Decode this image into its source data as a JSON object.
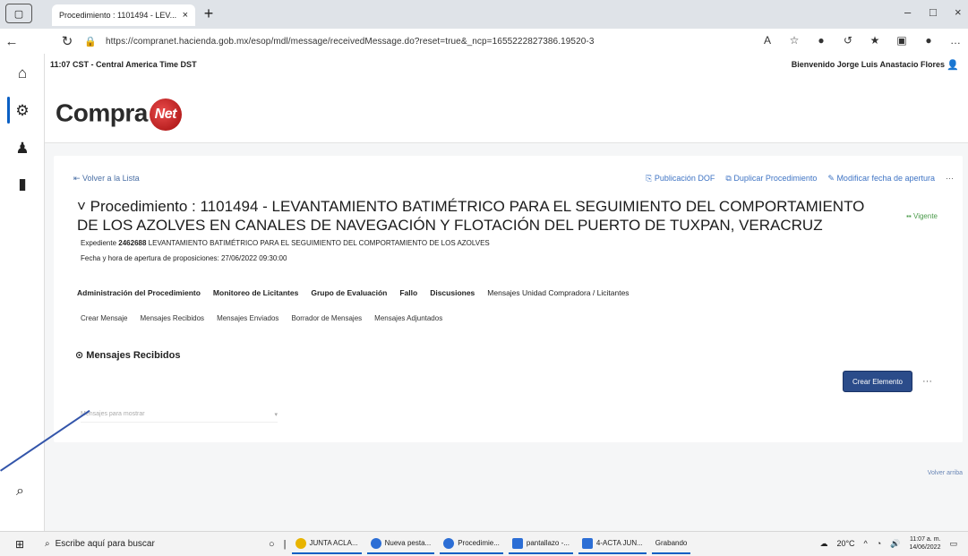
{
  "browser": {
    "tab_title": "Procedimiento : 1101494 - LEV...",
    "tab_close": "×",
    "new_tab": "+",
    "url": "https://compranet.hacienda.gob.mx/esop/mdl/message/receivedMessage.do?reset=true&_ncp=1655222827386.19520-3",
    "win_minimize": "–",
    "win_maximize": "□",
    "win_close": "×"
  },
  "page": {
    "time_zone": "11:07 CST - Central America Time DST",
    "welcome": "Bienvenido Jorge Luis Anastacio Flores",
    "logo_text": "Compra",
    "logo_badge": "Net",
    "back_link": "Volver a la Lista",
    "actions": {
      "publicacion": "Publicación DOF",
      "duplicar": "Duplicar Procedimiento",
      "modificar": "Modificar fecha de apertura",
      "more": "···"
    },
    "proc_title": "Procedimiento : 1101494 - LEVANTAMIENTO BATIMÉTRICO PARA EL SEGUIMIENTO DEL COMPORTAMIENTO DE LOS AZOLVES EN CANALES DE NAVEGACIÓN Y FLOTACIÓN DEL PUERTO DE TUXPAN, VERACRUZ",
    "status": "Vigente",
    "expediente_label": "Expediente",
    "expediente_num": "2462688",
    "expediente_desc": "LEVANTAMIENTO BATIMÉTRICO PARA EL SEGUIMIENTO DEL COMPORTAMIENTO DE LOS AZOLVES",
    "fecha": "Fecha y hora de apertura de proposiciones: 27/06/2022 09:30:00",
    "tabs_main": [
      "Administración del Procedimiento",
      "Monitoreo de Licitantes",
      "Grupo de Evaluación",
      "Fallo",
      "Discusiones",
      "Mensajes Unidad Compradora / Licitantes"
    ],
    "tabs_sub": [
      "Crear Mensaje",
      "Mensajes Recibidos",
      "Mensajes Enviados",
      "Borrador de Mensajes",
      "Mensajes Adjuntados"
    ],
    "section_heading": "Mensajes Recibidos",
    "crear_elemento": "Crear Elemento",
    "btn_more": "···",
    "select_placeholder": "Mensajes para mostrar",
    "volver_arriba": "Volver arriba"
  },
  "taskbar": {
    "search_placeholder": "Escribe aquí para buscar",
    "items": [
      "JUNTA ACLA...",
      "Nueva pesta...",
      "Procedimie...",
      "pantallazo -...",
      "4-ACTA JUN...",
      "Grabando"
    ],
    "temp": "20°C",
    "time": "11:07 a. m.",
    "date": "14/06/2022"
  }
}
